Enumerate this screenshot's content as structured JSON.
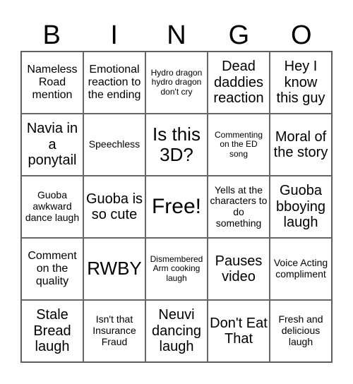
{
  "header": {
    "letters": [
      "B",
      "I",
      "N",
      "G",
      "O"
    ]
  },
  "cells": [
    [
      "Nameless Road mention",
      "Emotional reaction to the ending",
      "Hydro dragon hydro dragon don't cry",
      "Dead daddies reaction",
      "Hey I know this guy"
    ],
    [
      "Navia in a ponytail",
      "Speechless",
      "Is this 3D?",
      "Commenting on the ED song",
      "Moral of the story"
    ],
    [
      "Guoba awkward dance laugh",
      "Guoba is so cute",
      "Free!",
      "Yells at the characters to do something",
      "Guoba bboying laugh"
    ],
    [
      "Comment on the quality",
      "RWBY",
      "Dismembered Arm cooking laugh",
      "Pauses video",
      "Voice Acting compliment"
    ],
    [
      "Stale Bread laugh",
      "Isn't that Insurance Fraud",
      "Neuvi dancing laugh",
      "Don't Eat That",
      "Fresh and delicious laugh"
    ]
  ]
}
